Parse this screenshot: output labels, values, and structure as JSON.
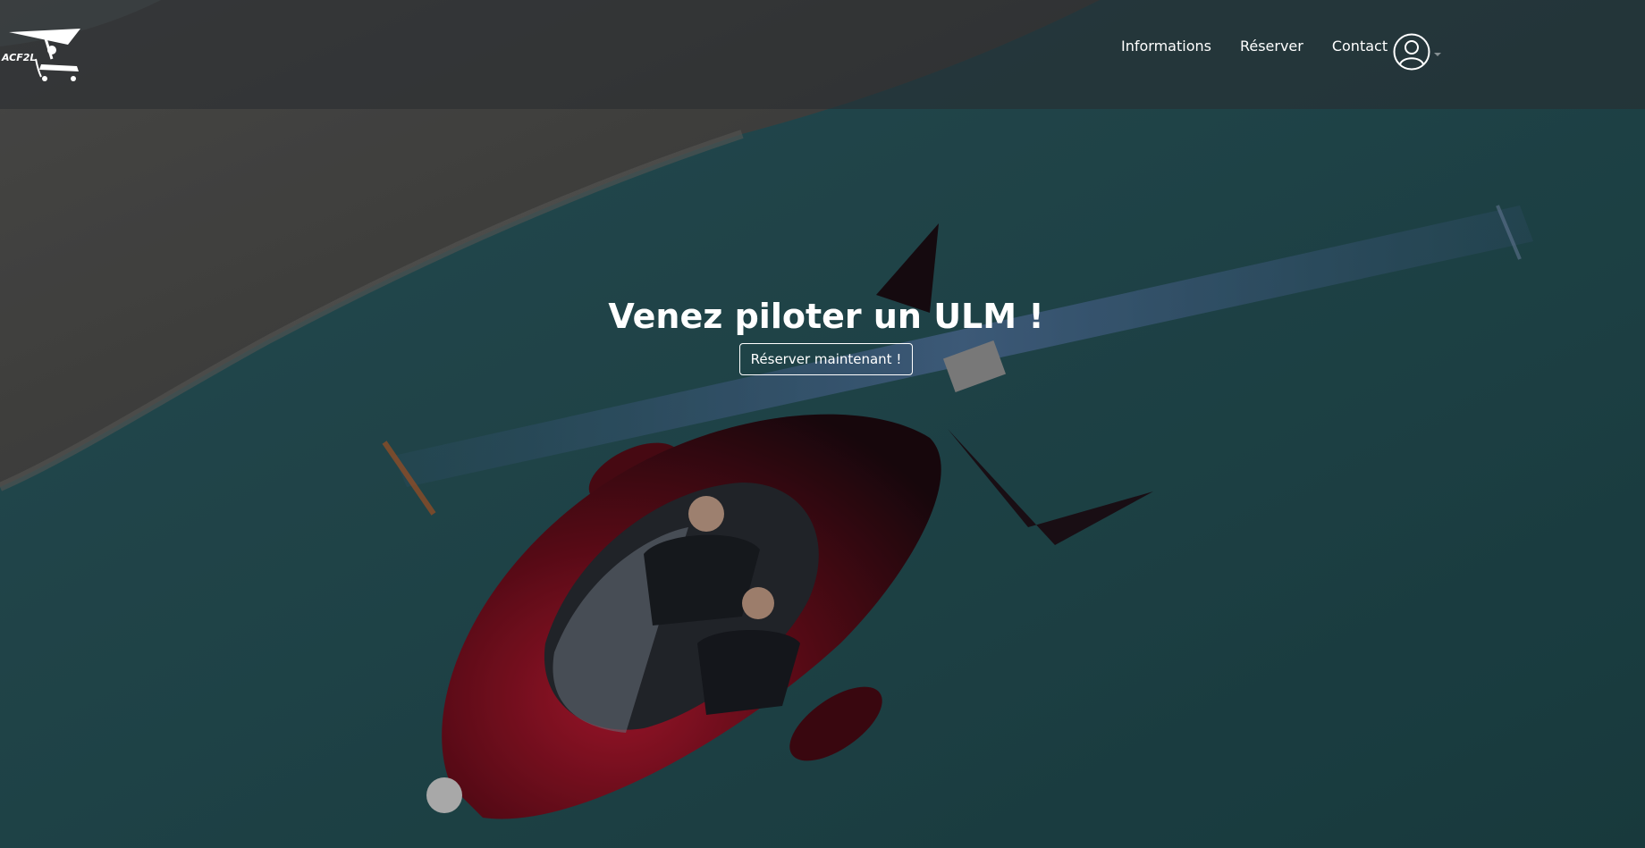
{
  "brand": {
    "logo_text": "ACF2L",
    "logo_icon": "ultralight-plane-icon"
  },
  "nav": {
    "items": [
      {
        "label": "Informations"
      },
      {
        "label": "Réserver"
      },
      {
        "label": "Contact"
      }
    ],
    "user_icon": "user-circle-icon"
  },
  "hero": {
    "title": "Venez piloter un ULM !",
    "cta_label": "Réserver maintenant !",
    "background": "photo: red autogyro flying over water and shoreline"
  },
  "colors": {
    "text": "#ffffff",
    "water": "#1f4a4e",
    "shore": "#4a4a48",
    "aircraft": "#7a0f1e",
    "rotor": "#3d5a80"
  }
}
